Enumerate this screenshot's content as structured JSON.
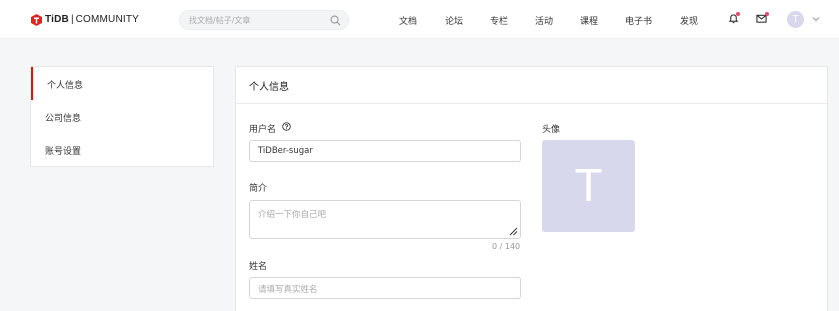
{
  "header": {
    "logo": {
      "brand": "TiDB",
      "separator": "|",
      "sub": "COMMUNITY"
    },
    "search_placeholder": "找文档/帖子/文章",
    "nav": [
      "文档",
      "论坛",
      "专栏",
      "活动",
      "课程",
      "电子书",
      "发现"
    ],
    "avatar_letter": "T",
    "notification_dot_color": "#e64b6e"
  },
  "sidebar": {
    "items": [
      {
        "label": "个人信息",
        "active": true
      },
      {
        "label": "公司信息"
      },
      {
        "label": "账号设置"
      }
    ],
    "accent_color": "#dc150b"
  },
  "main": {
    "title": "个人信息",
    "username": {
      "label": "用户名",
      "value": "TiDBer-sugar"
    },
    "bio": {
      "label": "简介",
      "placeholder": "介绍一下你自己吧",
      "counter": "0 / 140"
    },
    "name": {
      "label": "姓名",
      "placeholder": "请填写真实姓名"
    },
    "avatar": {
      "label": "头像",
      "letter": "T"
    }
  }
}
